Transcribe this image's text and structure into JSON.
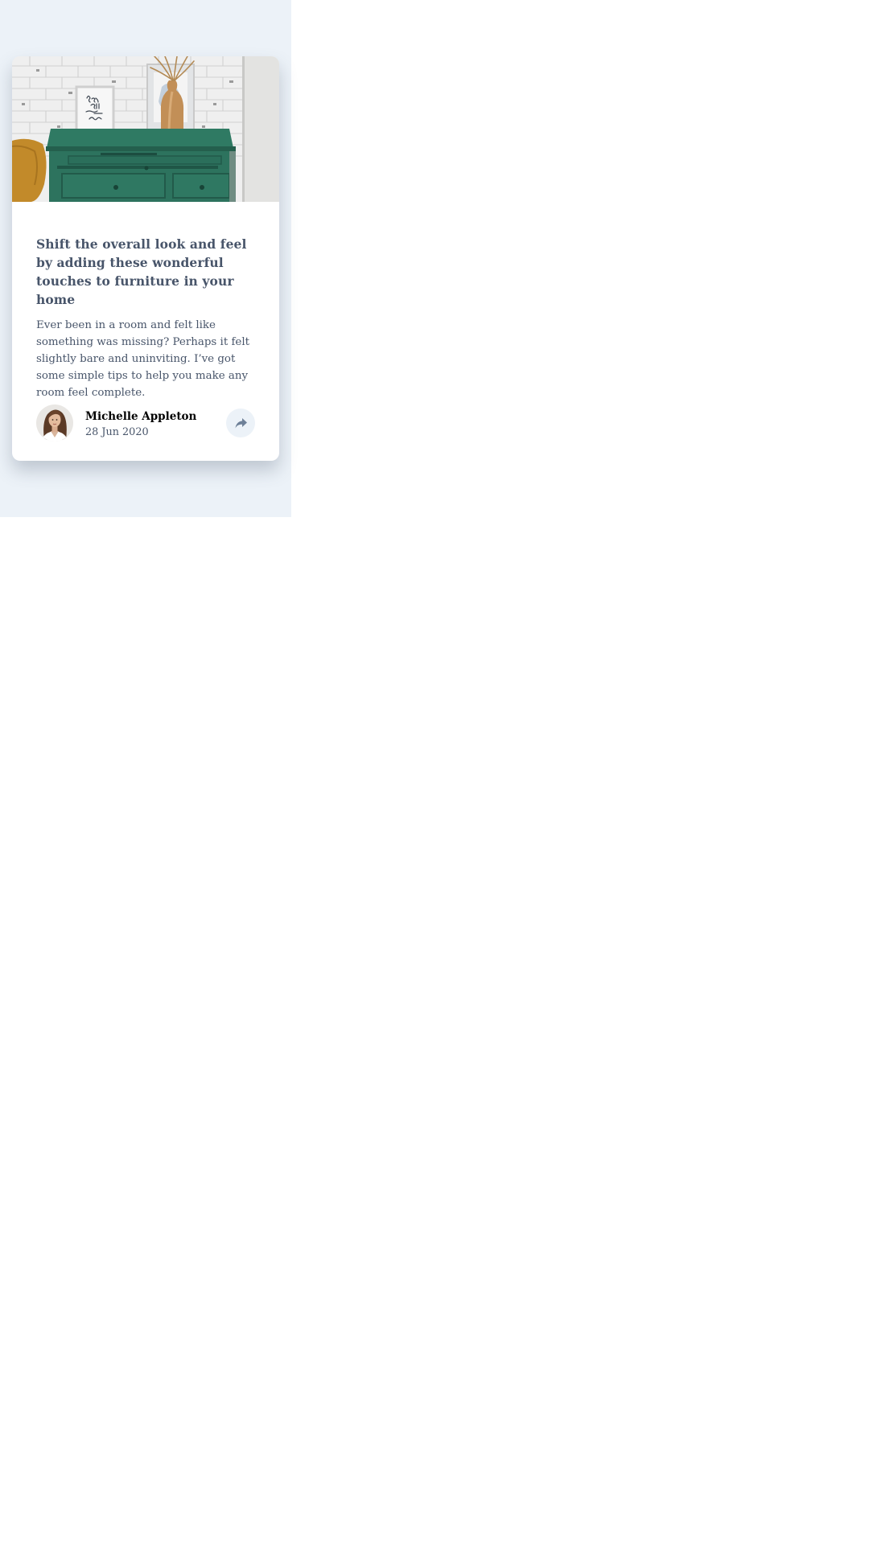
{
  "article": {
    "image_icon": "furniture-photo",
    "title": "Shift the overall look and feel by adding these wonderful touches to furniture in your home",
    "excerpt": "Ever been in a room and felt like something was missing? Perhaps it felt slightly bare and uninviting. I’ve got some simple tips to help you make any room feel complete."
  },
  "author": {
    "avatar_icon": "avatar-photo",
    "name": "Michelle Appleton",
    "date": "28 Jun 2020"
  },
  "share": {
    "icon": "share-arrow-icon"
  },
  "colors": {
    "page_background": "#ecf2f8",
    "card_background": "#ffffff",
    "text_dark": "#48556a",
    "share_button_bg": "#ecf2f8",
    "share_icon": "#6e8098"
  }
}
